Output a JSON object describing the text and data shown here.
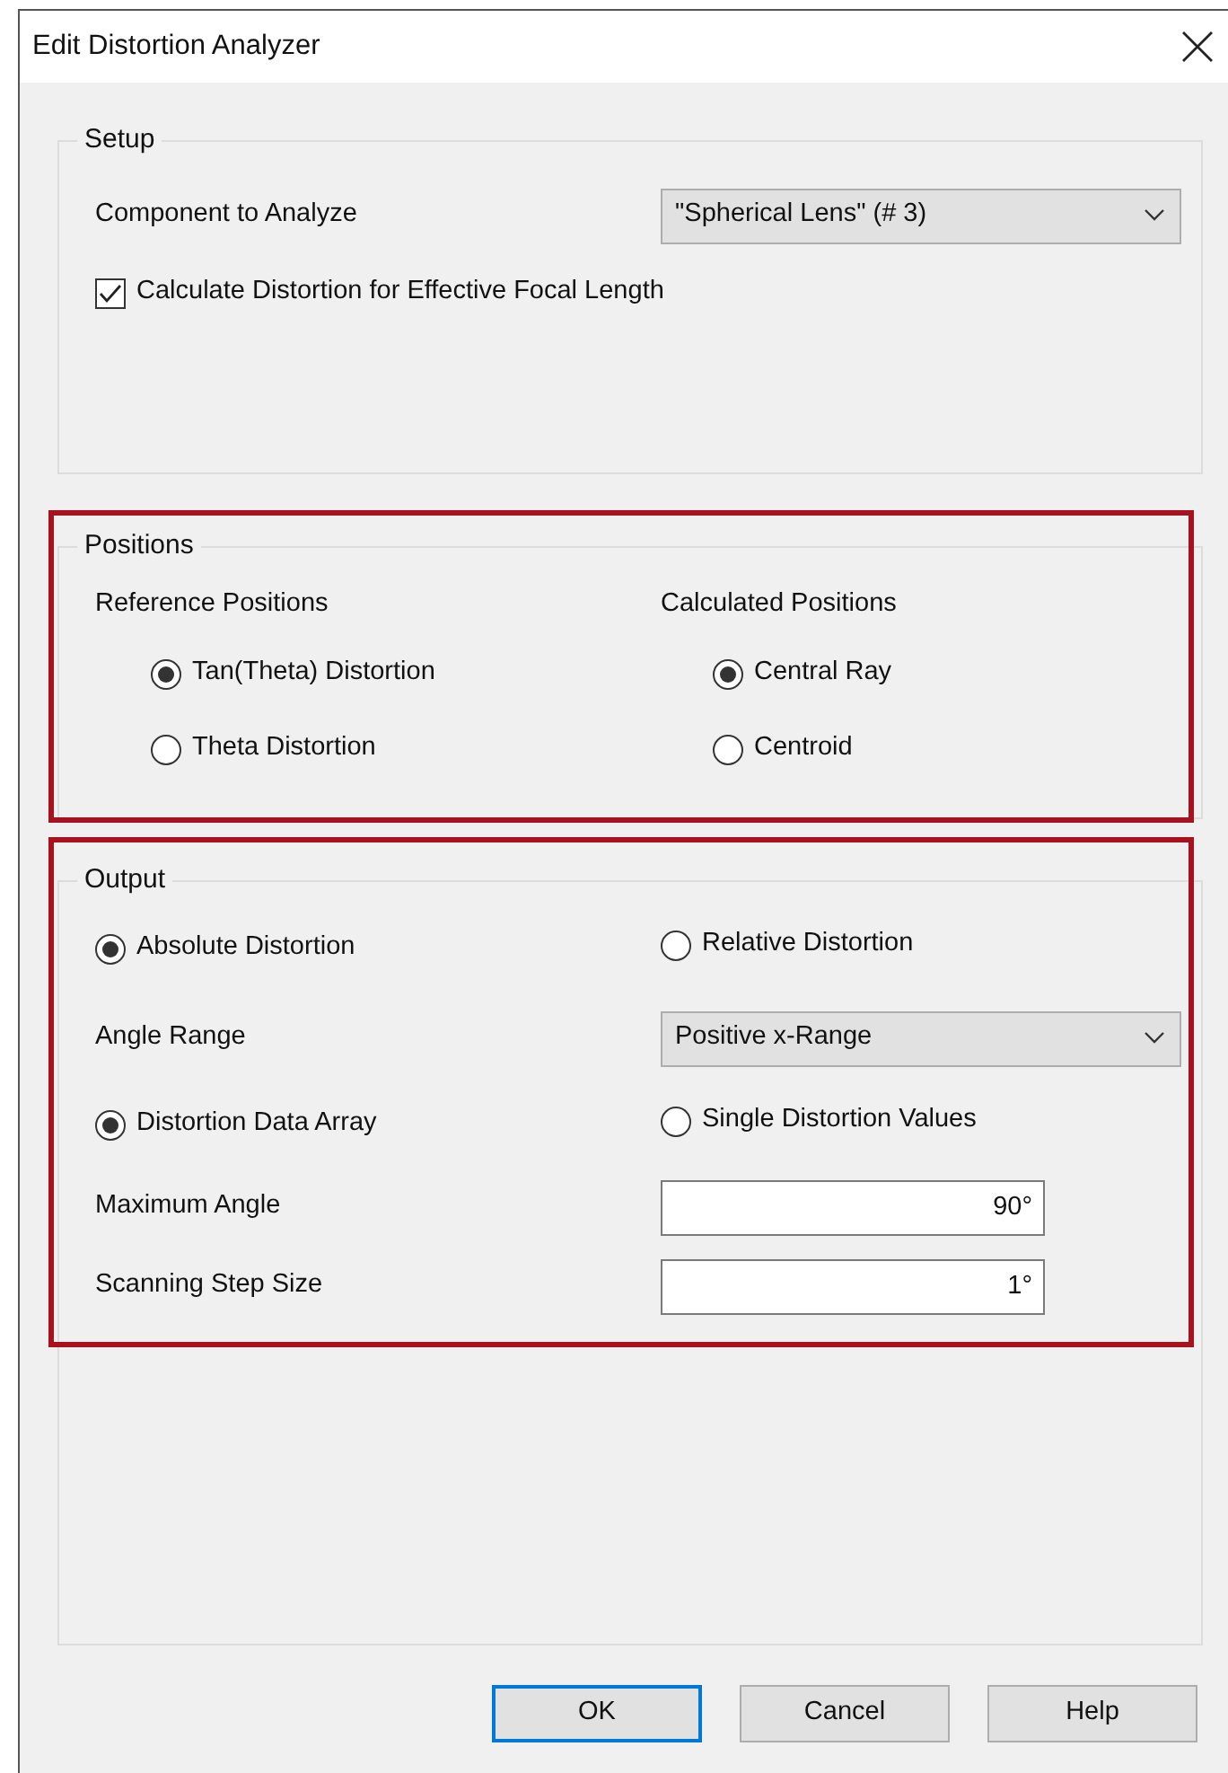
{
  "window": {
    "title": "Edit Distortion Analyzer"
  },
  "groups": [
    {
      "title": "Setup",
      "highlighted": false,
      "rows": [
        {
          "kind": "select",
          "label": "Component to Analyze",
          "value": "\"Spherical Lens\" (# 3)"
        },
        {
          "kind": "checkbox",
          "label": "Calculate Distortion for Effective Focal Length",
          "checked": true
        }
      ]
    },
    {
      "title": "Positions",
      "highlighted": true,
      "rows": [
        {
          "kind": "headings",
          "left": "Reference Positions",
          "right": "Calculated Positions"
        },
        {
          "kind": "sub-radios",
          "options": [
            {
              "label": "Tan(Theta) Distortion",
              "selected": true
            },
            {
              "label": "Central Ray",
              "selected": true
            }
          ]
        },
        {
          "kind": "sub-radios",
          "options": [
            {
              "label": "Theta Distortion",
              "selected": false
            },
            {
              "label": "Centroid",
              "selected": false
            }
          ]
        }
      ]
    },
    {
      "title": "Output",
      "highlighted": true,
      "rows": [
        {
          "kind": "radios",
          "options": [
            {
              "label": "Absolute Distortion",
              "selected": true
            },
            {
              "label": "Relative Distortion",
              "selected": false
            }
          ]
        },
        {
          "kind": "select",
          "label": "Angle Range",
          "value": "Positive x-Range"
        },
        {
          "kind": "radios",
          "options": [
            {
              "label": "Distortion Data Array",
              "selected": true
            },
            {
              "label": "Single Distortion Values",
              "selected": false
            }
          ]
        },
        {
          "kind": "input",
          "label": "Maximum Angle",
          "value": "90°"
        },
        {
          "kind": "input",
          "label": "Scanning Step Size",
          "value": "1°"
        }
      ]
    }
  ],
  "buttons": [
    {
      "label": "OK",
      "default": true
    },
    {
      "label": "Cancel",
      "default": false
    },
    {
      "label": "Help",
      "default": false
    }
  ]
}
